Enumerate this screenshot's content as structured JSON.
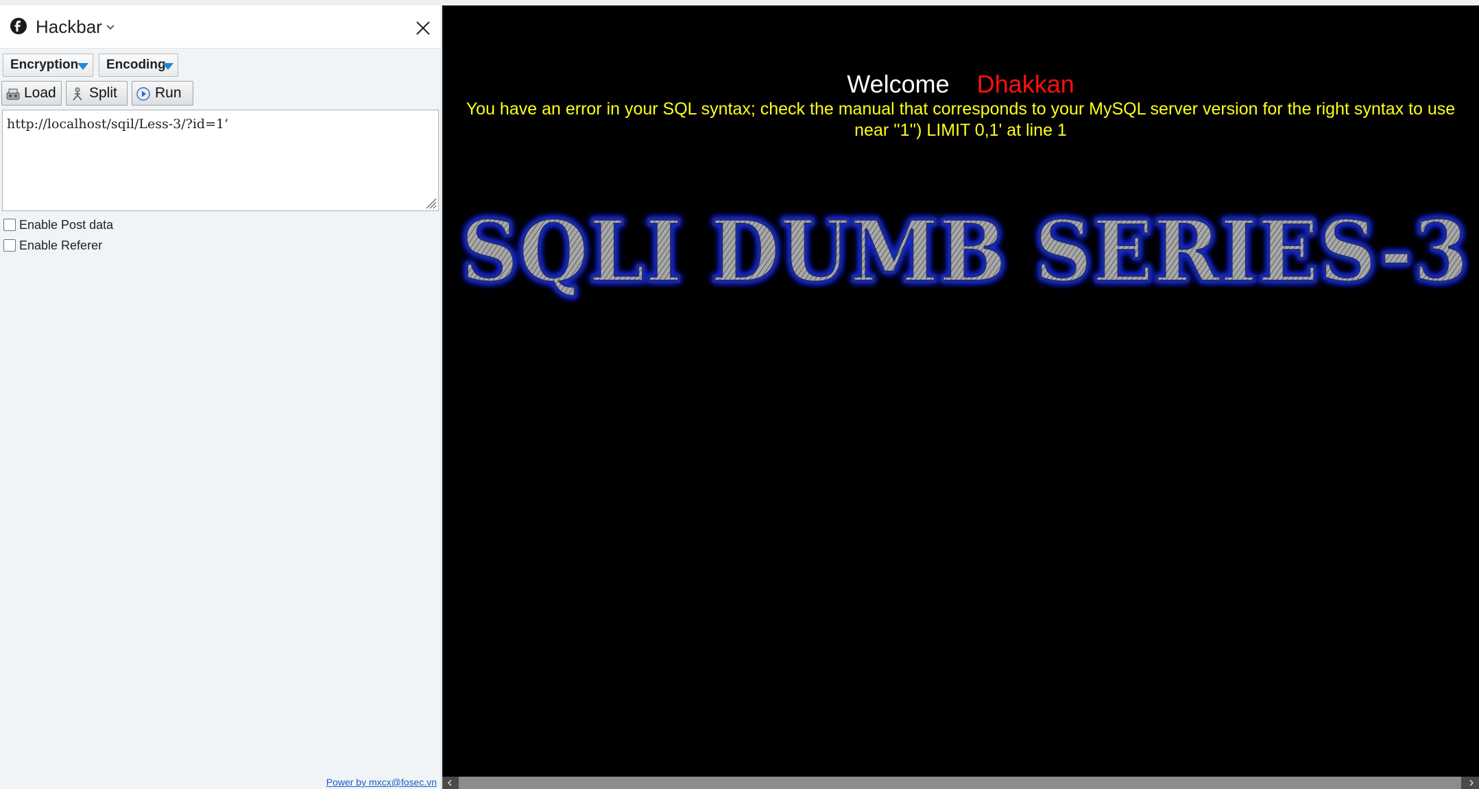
{
  "hackbar": {
    "title": "Hackbar",
    "encryption_label": "Encryption",
    "encoding_label": "Encoding",
    "load_label": "Load",
    "split_label": "Split",
    "run_label": "Run",
    "url_value": "http://localhost/sqil/Less-3/?id=1’",
    "enable_post_label": "Enable Post data",
    "enable_referer_label": "Enable Referer",
    "enable_post_checked": false,
    "enable_referer_checked": false,
    "powered_by": "Power by mxcx@fosec.vn"
  },
  "page": {
    "welcome_label": "Welcome",
    "username": "Dhakkan",
    "sql_error": "You have an error in your SQL syntax; check the manual that corresponds to your MySQL server version for the right syntax to use near ''1'') LIMIT 0,1' at line 1",
    "banner_text": "SQLI DUMB SERIES-3"
  },
  "colors": {
    "welcome": "#ffffff",
    "username": "#ff1010",
    "sql_error": "#ffff1a",
    "page_background": "#000000",
    "dropdown_arrow": "#1f86d6",
    "banner_glow": "#1a2cff"
  }
}
